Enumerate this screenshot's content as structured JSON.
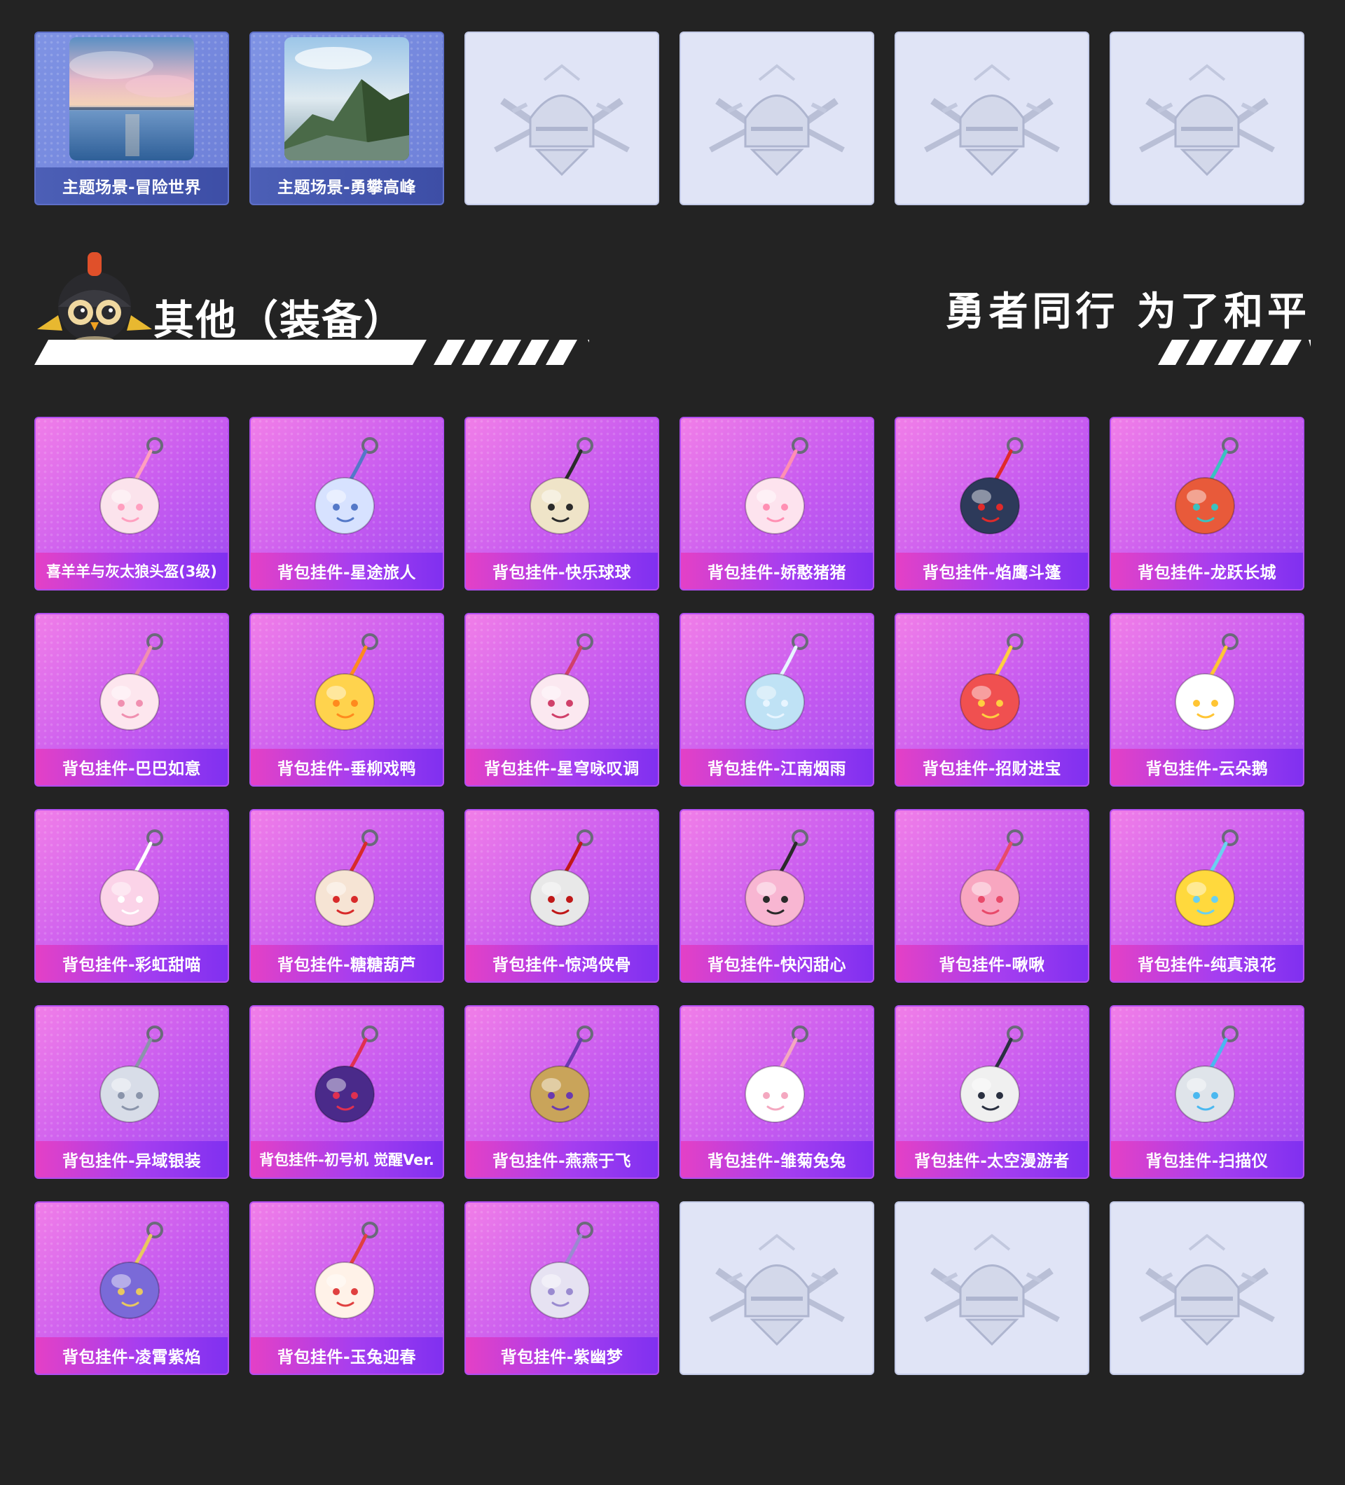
{
  "top_row": [
    {
      "type": "scene",
      "label": "主题场景-冒险世界",
      "art": "sunset-sea-thumbnail"
    },
    {
      "type": "scene",
      "label": "主题场景-勇攀高峰",
      "art": "mountain-valley-thumbnail"
    },
    {
      "type": "empty",
      "art": "helmet-emblem"
    },
    {
      "type": "empty",
      "art": "helmet-emblem"
    },
    {
      "type": "empty",
      "art": "helmet-emblem"
    },
    {
      "type": "empty",
      "art": "helmet-emblem"
    }
  ],
  "section": {
    "title": "其他（装备）",
    "slogan": "勇者同行 为了和平"
  },
  "items": [
    {
      "label": "喜羊羊与灰太狼头盔(3级)",
      "icon": "sheep-helmet-icon",
      "color": "#fbe3ec",
      "accent": "#ff9fbf"
    },
    {
      "label": "背包挂件-星途旅人",
      "icon": "space-shuttle-charm-icon",
      "color": "#d7e2ff",
      "accent": "#5478c8"
    },
    {
      "label": "背包挂件-快乐球球",
      "icon": "helmet-ball-charm-icon",
      "color": "#efe4c8",
      "accent": "#2b2b2b"
    },
    {
      "label": "背包挂件-娇憨猪猪",
      "icon": "pig-charm-icon",
      "color": "#fde3ee",
      "accent": "#ff8fb3"
    },
    {
      "label": "背包挂件-焰鹰斗篷",
      "icon": "knot-tassel-charm-icon",
      "color": "#2d3a5a",
      "accent": "#e02a2a"
    },
    {
      "label": "背包挂件-龙跃长城",
      "icon": "lion-dance-charm-icon",
      "color": "#e85a3a",
      "accent": "#3ac2c0"
    },
    {
      "label": "背包挂件-巴巴如意",
      "icon": "fox-charm-icon",
      "color": "#fde6ee",
      "accent": "#f08fb0"
    },
    {
      "label": "背包挂件-垂柳戏鸭",
      "icon": "duck-charm-icon",
      "color": "#ffd34d",
      "accent": "#ff8a1e"
    },
    {
      "label": "背包挂件-星穹咏叹调",
      "icon": "heart-mask-charm-icon",
      "color": "#fbe8f0",
      "accent": "#d0406a"
    },
    {
      "label": "背包挂件-江南烟雨",
      "icon": "flower-charm-icon",
      "color": "#bfe2f5",
      "accent": "#e8f5ff"
    },
    {
      "label": "背包挂件-招财进宝",
      "icon": "lucky-doll-charm-icon",
      "color": "#f05050",
      "accent": "#ffcf40"
    },
    {
      "label": "背包挂件-云朵鹅",
      "icon": "goose-charm-icon",
      "color": "#ffffff",
      "accent": "#ffc534"
    },
    {
      "label": "背包挂件-彩虹甜喵",
      "icon": "paw-charm-icon",
      "color": "#fbd3e8",
      "accent": "#ffffff"
    },
    {
      "label": "背包挂件-糖糖葫芦",
      "icon": "gourd-charm-icon",
      "color": "#f6e4d4",
      "accent": "#d82a2a"
    },
    {
      "label": "背包挂件-惊鸿侠骨",
      "icon": "ring-tassel-charm-icon",
      "color": "#e8e8e8",
      "accent": "#c01818"
    },
    {
      "label": "背包挂件-快闪甜心",
      "icon": "cat-disc-charm-icon",
      "color": "#f8b6d2",
      "accent": "#2a2a2a"
    },
    {
      "label": "背包挂件-啾啾",
      "icon": "bird-charm-icon",
      "color": "#f8a6c0",
      "accent": "#e84a6a"
    },
    {
      "label": "背包挂件-纯真浪花",
      "icon": "opener-charm-icon",
      "color": "#ffd93d",
      "accent": "#6ad0f0"
    },
    {
      "label": "背包挂件-异域银装",
      "icon": "silver-wing-charm-icon",
      "color": "#d8dde8",
      "accent": "#8a94aa"
    },
    {
      "label": "背包挂件-初号机 觉醒Ver.",
      "icon": "crystal-blade-charm-icon",
      "color": "#4a2a8a",
      "accent": "#e03050"
    },
    {
      "label": "背包挂件-燕燕于飞",
      "icon": "swallow-charm-icon",
      "color": "#c9a45a",
      "accent": "#6a3ab0"
    },
    {
      "label": "背包挂件-雏菊兔兔",
      "icon": "bunny-charm-icon",
      "color": "#ffffff",
      "accent": "#f4a8c0"
    },
    {
      "label": "背包挂件-太空漫游者",
      "icon": "astronaut-charm-icon",
      "color": "#f0f0f0",
      "accent": "#2a3040"
    },
    {
      "label": "背包挂件-扫描仪",
      "icon": "ghost-shell-charm-icon",
      "color": "#dfe4ea",
      "accent": "#4ab8f0"
    },
    {
      "label": "背包挂件-凌霄紫焰",
      "icon": "purple-flame-charm-icon",
      "color": "#7a6ad8",
      "accent": "#e8c860"
    },
    {
      "label": "背包挂件-玉兔迎春",
      "icon": "jade-rabbit-charm-icon",
      "color": "#fff2e8",
      "accent": "#e04040"
    },
    {
      "label": "背包挂件-紫幽梦",
      "icon": "bell-flower-charm-icon",
      "color": "#e6e2f2",
      "accent": "#9a8ad0"
    },
    {
      "type": "empty",
      "art": "helmet-emblem"
    },
    {
      "type": "empty",
      "art": "helmet-emblem"
    },
    {
      "type": "empty",
      "art": "helmet-emblem"
    }
  ],
  "colors": {
    "background": "#232323",
    "item_card": "#c65af0",
    "scene_card": "#6d7fd8",
    "empty_card": "#e0e4f6"
  }
}
